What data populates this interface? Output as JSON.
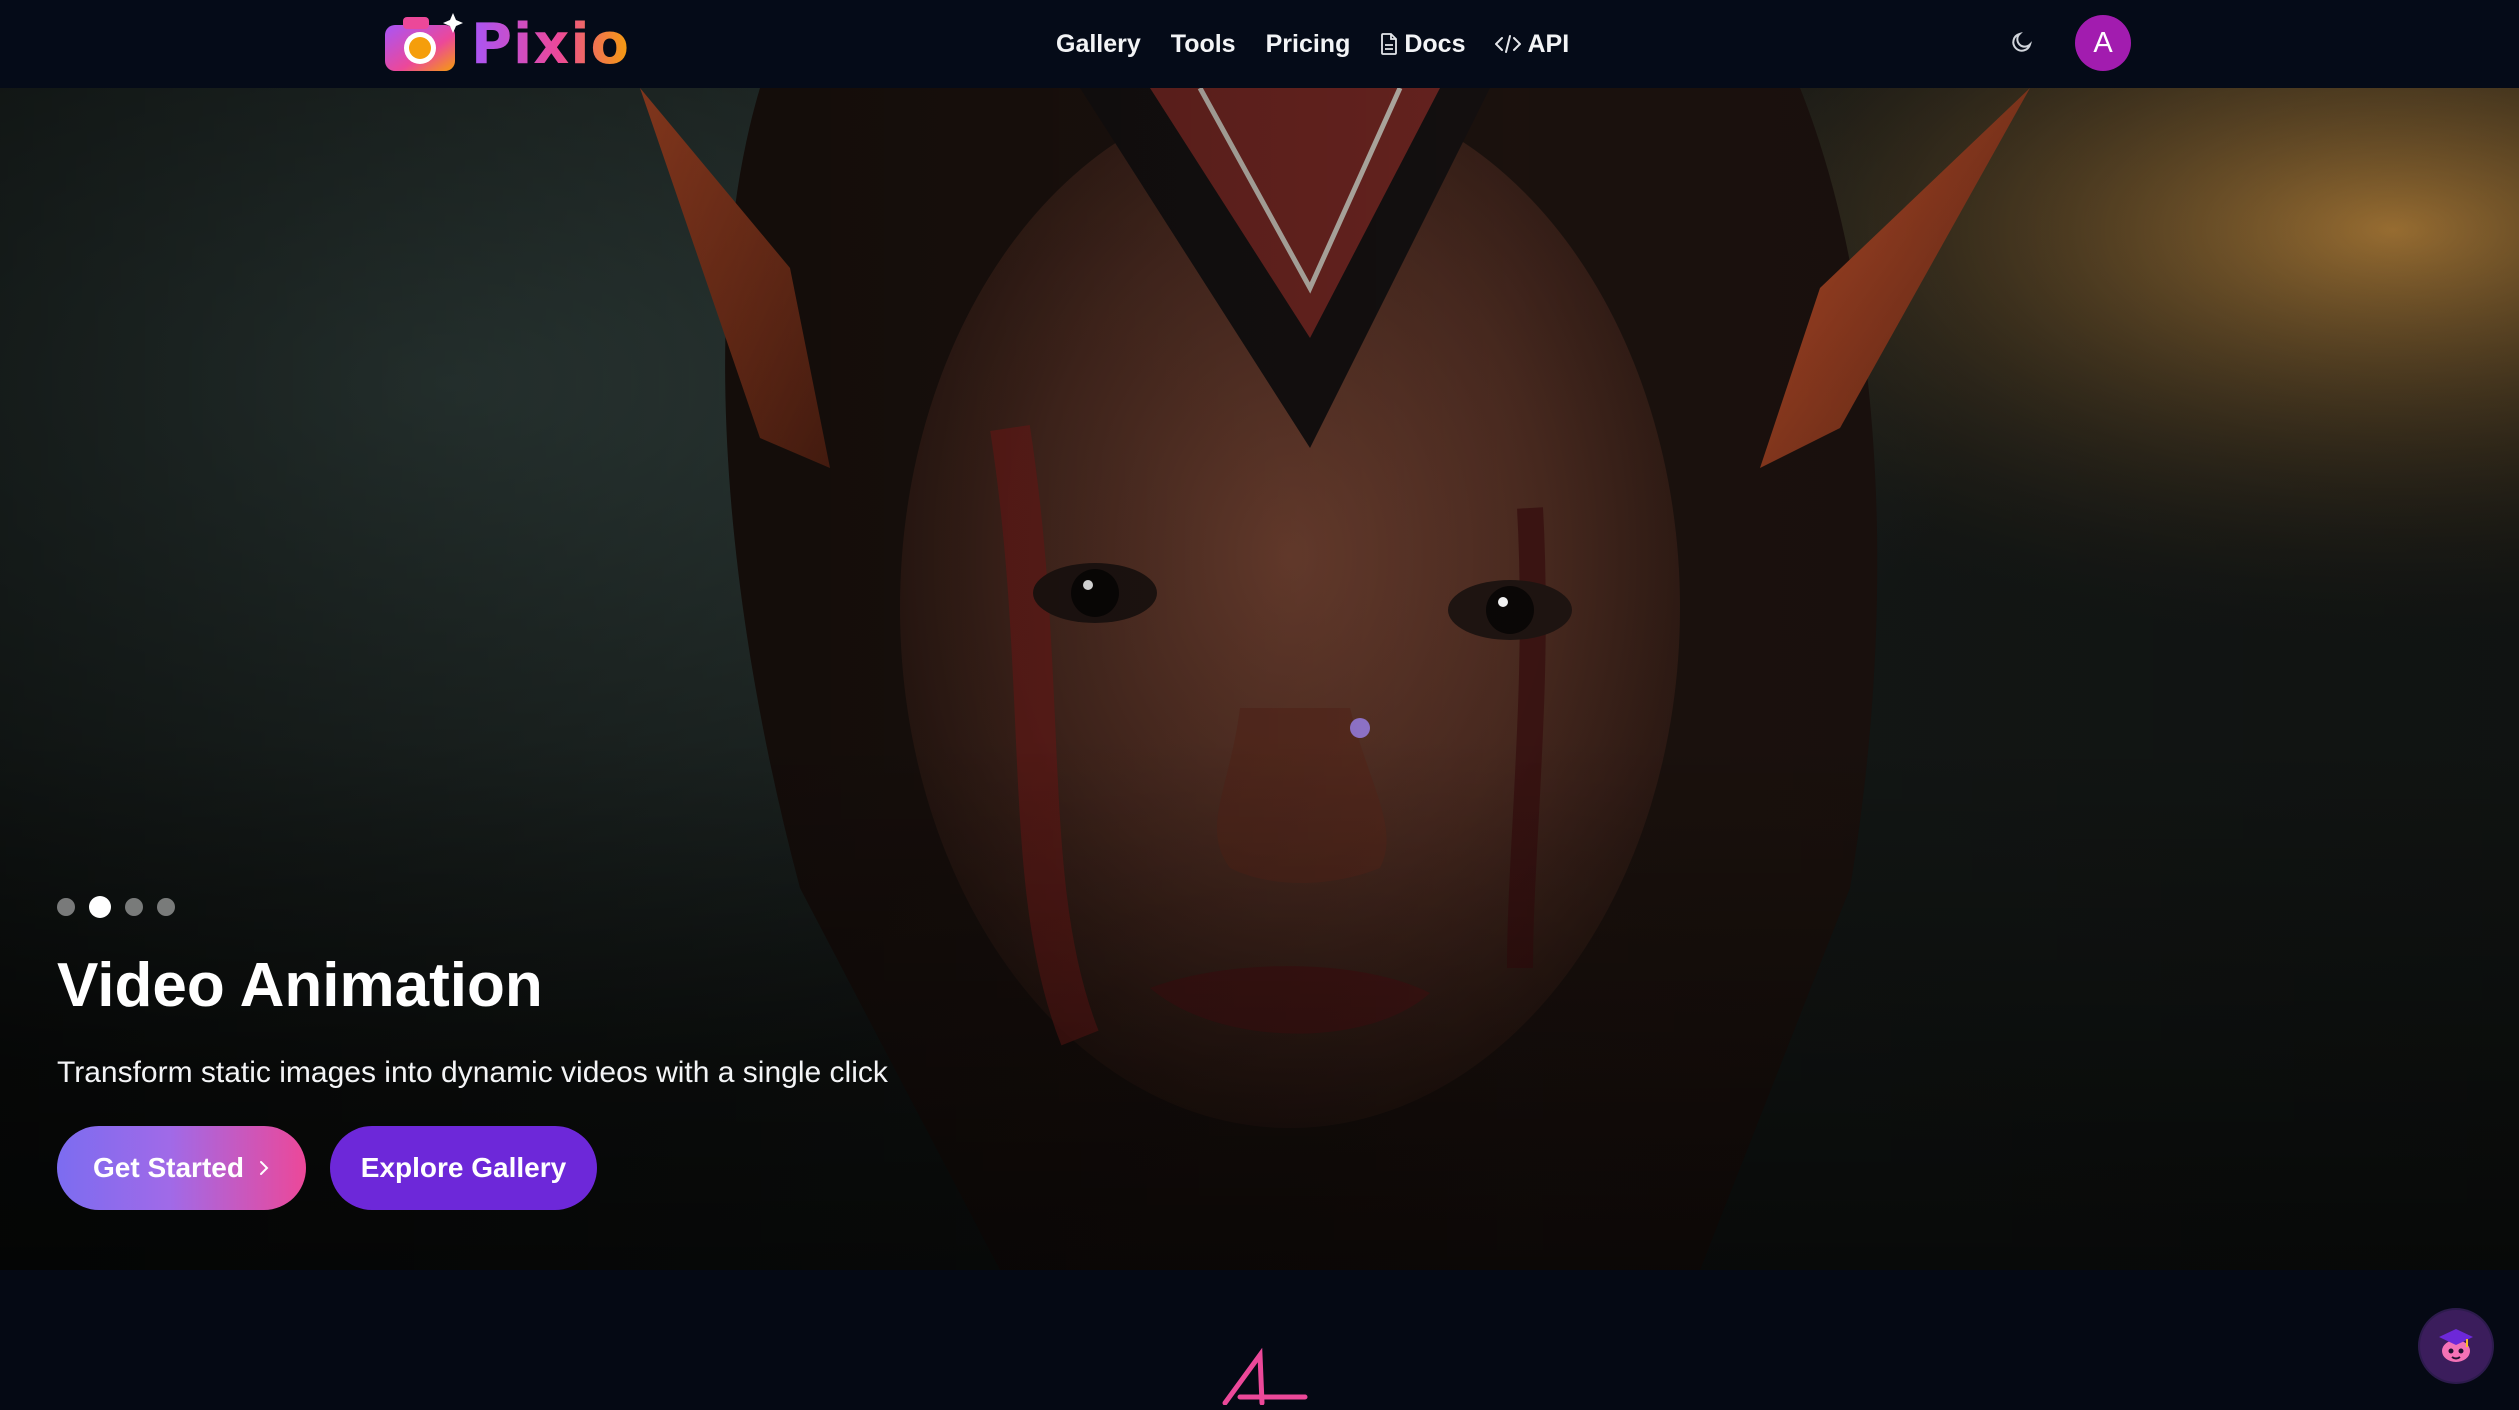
{
  "brand": {
    "name": "Pixio",
    "logo_icon": "camera-icon"
  },
  "nav": {
    "links": [
      {
        "label": "Gallery"
      },
      {
        "label": "Tools"
      },
      {
        "label": "Pricing"
      },
      {
        "label": "Docs",
        "icon": "document-icon"
      },
      {
        "label": "API",
        "icon": "code-icon"
      }
    ],
    "theme_icon": "moon-icon",
    "avatar_initial": "A"
  },
  "hero": {
    "title": "Video Animation",
    "subtitle": "Transform static images into dynamic videos with a single click",
    "primary_button": "Get Started",
    "primary_button_icon": "chevron-right-icon",
    "secondary_button": "Explore Gallery",
    "slides_total": 4,
    "active_slide": 2
  },
  "assistant": {
    "icon": "graduation-mascot-icon"
  },
  "colors": {
    "nav_bg": "#050b18",
    "page_bg": "#050914",
    "accent_purple": "#6d28d9",
    "accent_pink": "#ec4899",
    "avatar_bg": "#a21caf"
  }
}
